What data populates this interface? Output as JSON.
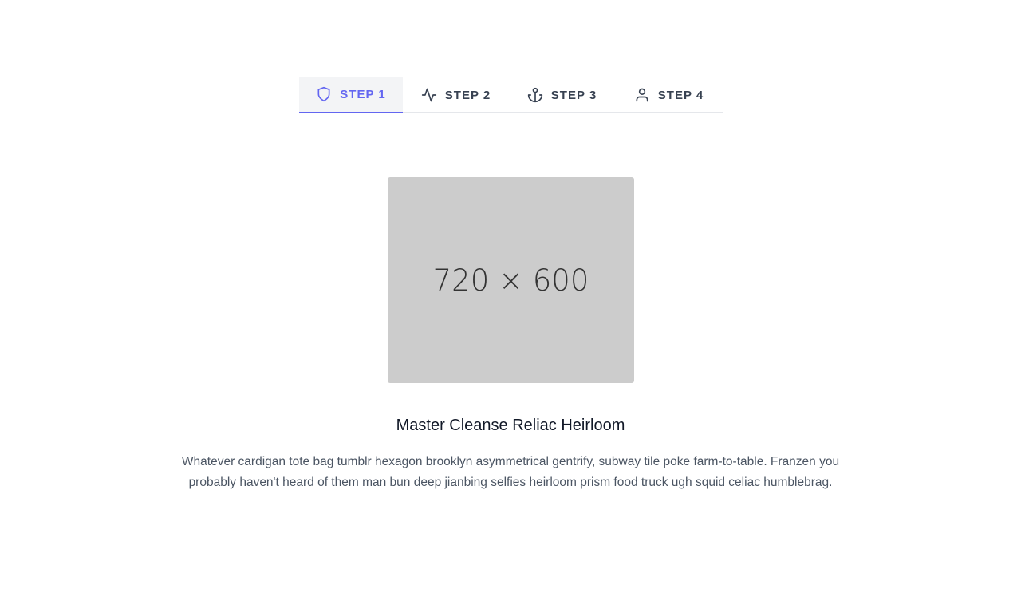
{
  "tabs": [
    {
      "label": "STEP 1",
      "icon": "shield-icon",
      "active": true
    },
    {
      "label": "STEP 2",
      "icon": "activity-icon",
      "active": false
    },
    {
      "label": "STEP 3",
      "icon": "anchor-icon",
      "active": false
    },
    {
      "label": "STEP 4",
      "icon": "user-icon",
      "active": false
    }
  ],
  "content": {
    "image_placeholder": "720 × 600",
    "title": "Master Cleanse Reliac Heirloom",
    "description": "Whatever cardigan tote bag tumblr hexagon brooklyn asymmetrical gentrify, subway tile poke farm-to-table. Franzen you probably haven't heard of them man bun deep jianbing selfies heirloom prism food truck ugh squid celiac humblebrag."
  },
  "colors": {
    "accent": "#6366f1",
    "active_tab_bg": "#f3f4f6",
    "placeholder_bg": "#cccccc"
  }
}
